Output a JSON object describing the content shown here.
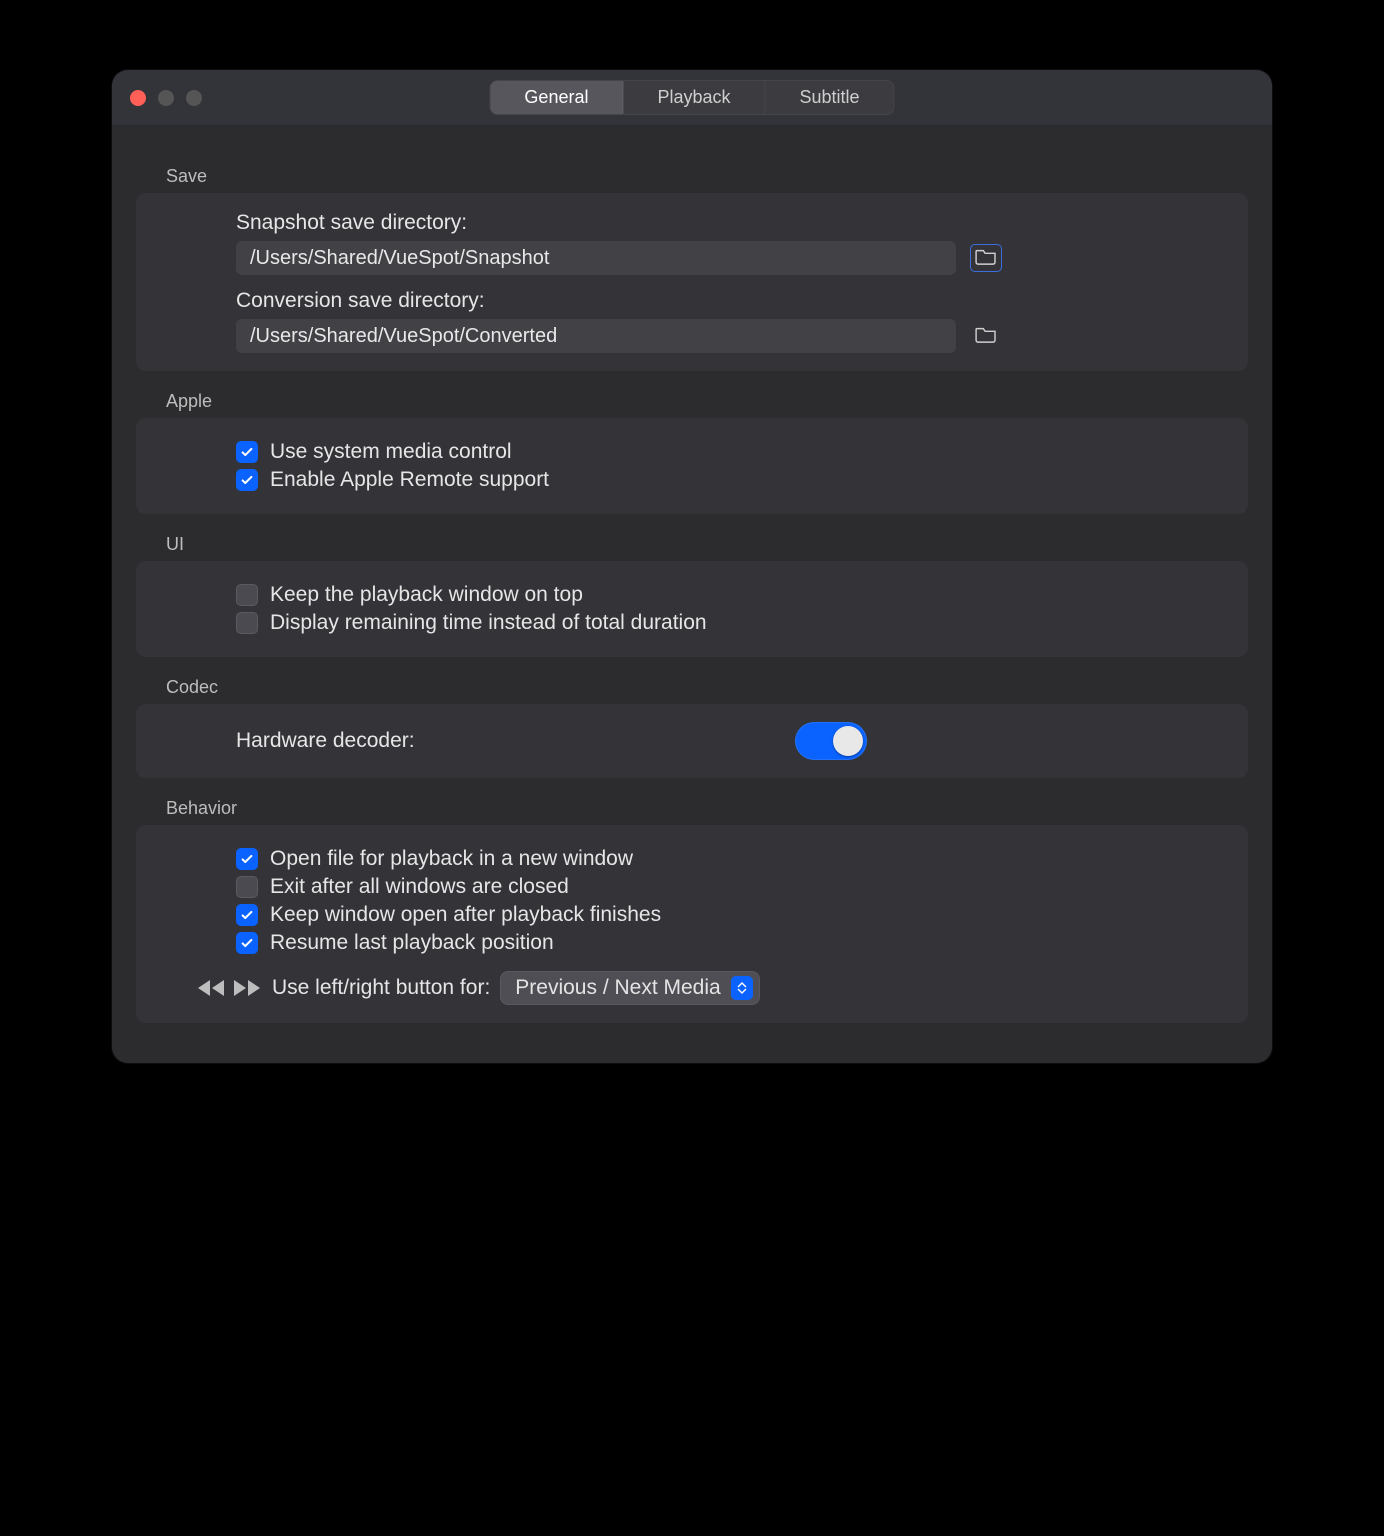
{
  "tabs": [
    "General",
    "Playback",
    "Subtitle"
  ],
  "active_tab_index": 0,
  "sections": {
    "save": {
      "label": "Save",
      "snapshot_label": "Snapshot save directory:",
      "snapshot_value": "/Users/Shared/VueSpot/Snapshot",
      "conversion_label": "Conversion save directory:",
      "conversion_value": "/Users/Shared/VueSpot/Converted"
    },
    "apple": {
      "label": "Apple",
      "items": [
        {
          "label": "Use system media control",
          "checked": true
        },
        {
          "label": "Enable Apple Remote support",
          "checked": true
        }
      ]
    },
    "ui": {
      "label": "UI",
      "items": [
        {
          "label": "Keep the playback window on top",
          "checked": false
        },
        {
          "label": "Display remaining time instead of total duration",
          "checked": false
        }
      ]
    },
    "codec": {
      "label": "Codec",
      "hw_label": "Hardware decoder:",
      "hw_enabled": true
    },
    "behavior": {
      "label": "Behavior",
      "items": [
        {
          "label": "Open file for playback in a new window",
          "checked": true
        },
        {
          "label": "Exit after all windows are closed",
          "checked": false
        },
        {
          "label": "Keep window open after playback finishes",
          "checked": true
        },
        {
          "label": "Resume last playback position",
          "checked": true
        }
      ],
      "lr_label": "Use left/right button for:",
      "lr_value": "Previous / Next Media"
    }
  }
}
